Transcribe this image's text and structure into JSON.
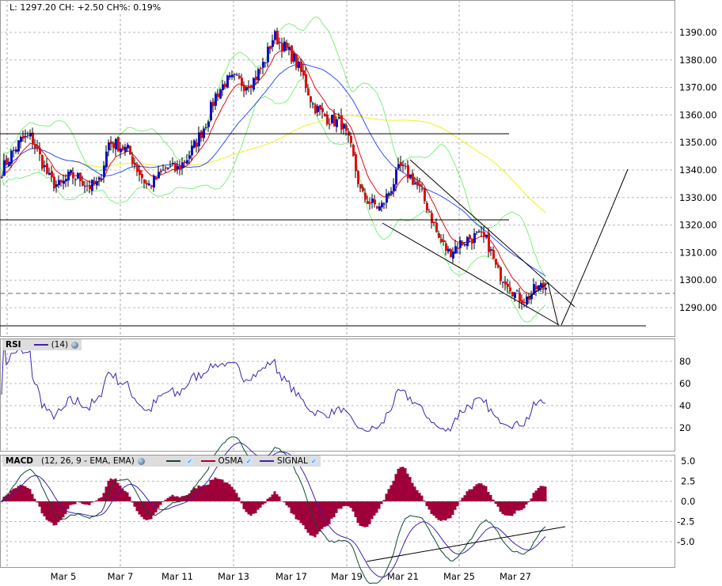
{
  "header": {
    "text": "L: 1297.20 CH: +2.50 CH%: 0.19%"
  },
  "rsi_legend": {
    "label": "RSI",
    "param": "(14)"
  },
  "macd_legend": {
    "label": "MACD",
    "params": "(12, 26, 9 - EMA, EMA)",
    "osma": "OSMA",
    "signal": "SIGNAL"
  },
  "colors": {
    "up": "#1010c8",
    "down": "#e01010",
    "ma_fast": "#e01010",
    "ma_mid": "#3050ff",
    "ma_slow": "#f0f020",
    "bands": "#80f080",
    "rsi": "#4020b0",
    "macd": "#104838",
    "signal": "#4020b0",
    "osma": "#a0003a"
  },
  "chart_data": {
    "type": "candlestick",
    "price_axis": {
      "ticks": [
        "1390.00",
        "1380.00",
        "1370.00",
        "1360.00",
        "1350.00",
        "1340.00",
        "1330.00",
        "1320.00",
        "1310.00",
        "1300.00",
        "1290.00"
      ],
      "range": [
        1278,
        1400
      ]
    },
    "x_labels": [
      "Mar 5",
      "Mar 7",
      "Mar 11",
      "Mar 13",
      "Mar 17",
      "Mar 19",
      "Mar 21",
      "Mar 25",
      "Mar 27"
    ],
    "close_path": [
      1340,
      1346,
      1351,
      1352,
      1344,
      1336,
      1334,
      1338,
      1337,
      1334,
      1335,
      1350,
      1349,
      1347,
      1340,
      1334,
      1337,
      1341,
      1340,
      1344,
      1350,
      1357,
      1367,
      1372,
      1373,
      1371,
      1373,
      1379,
      1389,
      1385,
      1381,
      1374,
      1364,
      1360,
      1358,
      1357,
      1347,
      1331,
      1328,
      1326,
      1333,
      1341,
      1338,
      1333,
      1325,
      1315,
      1310,
      1313,
      1315,
      1316,
      1314,
      1303,
      1300,
      1294,
      1293,
      1297,
      1298
    ],
    "last_price": 1297.2,
    "horizontal_levels": [
      1353.2,
      1321.9,
      1283.4
    ],
    "rsi": {
      "ticks": [
        "80",
        "60",
        "40",
        "20"
      ],
      "range": [
        0,
        100
      ]
    },
    "macd": {
      "ticks": [
        "5.0",
        "2.5",
        "0.0",
        "-2.5",
        "-5.0"
      ],
      "range": [
        -7.5,
        7.5
      ]
    }
  }
}
